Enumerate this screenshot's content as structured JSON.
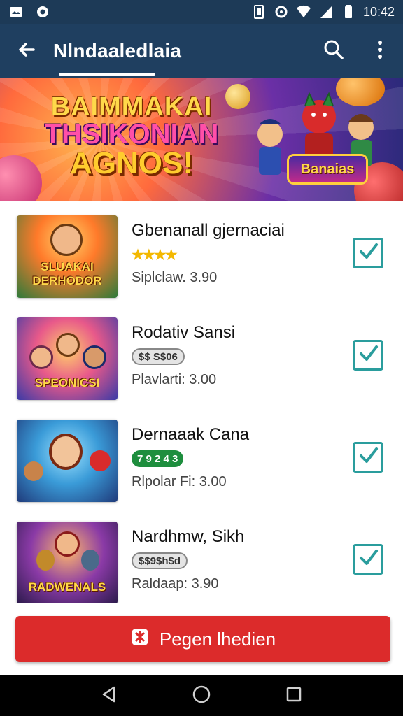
{
  "status_bar": {
    "time": "10:42",
    "icons": [
      "image-icon",
      "notification-icon",
      "sim-icon",
      "settings-icon",
      "wifi-icon",
      "signal-icon",
      "battery-icon"
    ]
  },
  "app_bar": {
    "title": "Nlndaaledlaia",
    "icons": [
      "back-arrow-icon",
      "search-icon",
      "more-vertical-icon"
    ]
  },
  "banner": {
    "line1": "BAIMMAKAI",
    "line2": "THSIKONIAN",
    "line3": "AGNOS!",
    "badge": "Banaias"
  },
  "games": [
    {
      "thumb_label": "SLUAKAI DERHODOR",
      "title": "Gbenanall gjernaciai",
      "badge_type": "stars",
      "badge": "★★★★",
      "subtitle": "Siplclaw. 3.90",
      "checked": true
    },
    {
      "thumb_label": "SPEONICSI",
      "title": "Rodativ Sansi",
      "badge_type": "gray",
      "badge": "$$ S$06",
      "subtitle": "Plavlarti: 3.00",
      "checked": true
    },
    {
      "thumb_label": "",
      "title": "Dernaaak Cana",
      "badge_type": "green",
      "badge": "7 9 2 4 3",
      "subtitle": "Rlpolar Fi: 3.00",
      "checked": true
    },
    {
      "thumb_label": "RADWENALS",
      "title": "Nardhmw, Sikh",
      "badge_type": "gray",
      "badge": "$$9$h$d",
      "subtitle": "Raldaap: 3.90",
      "checked": true
    }
  ],
  "primary_button": {
    "label": "Pegen lhedien",
    "icon": "puzzle-icon"
  },
  "nav_bar": {
    "icons": [
      "nav-back-icon",
      "nav-home-icon",
      "nav-recents-icon"
    ]
  },
  "colors": {
    "app_bar": "#1f3f60",
    "status_bar": "#1d3a57",
    "accent_red": "#dc2b2b",
    "check_teal": "#2a9d9d",
    "badge_green": "#1e8e3e"
  }
}
